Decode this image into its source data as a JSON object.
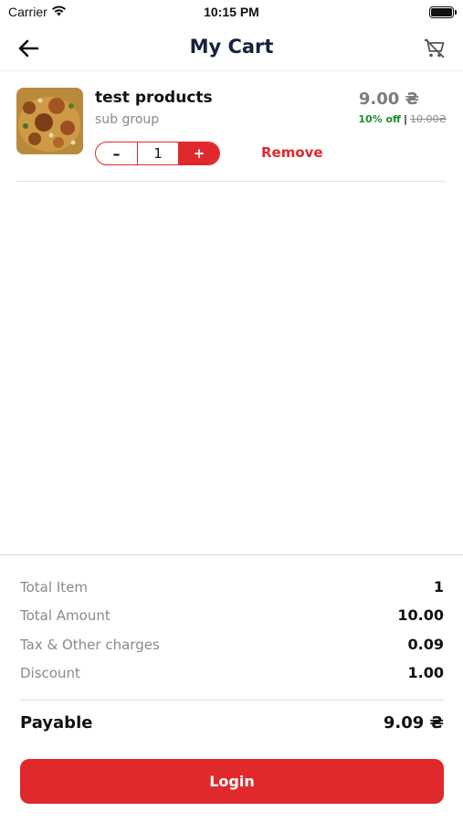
{
  "status_bar": {
    "carrier": "Carrier",
    "time": "10:15 PM",
    "wifi_icon": "wifi-icon",
    "battery_icon": "battery-icon"
  },
  "nav": {
    "title": "My Cart",
    "back_icon": "arrow-left-icon",
    "clear_cart_icon": "cart-remove-icon"
  },
  "cart_items": [
    {
      "name": "test products",
      "group": "sub group",
      "price": "9.00 ₴",
      "discount": "10% off",
      "separator": "|",
      "original_price": "10.00₴",
      "quantity": "1",
      "minus_label": "–",
      "plus_label": "+",
      "remove_label": "Remove"
    }
  ],
  "summary": {
    "total_item_label": "Total Item",
    "total_item_value": "1",
    "total_amount_label": "Total Amount",
    "total_amount_value": "10.00",
    "tax_label": "Tax & Other charges",
    "tax_value": "0.09",
    "discount_label": "Discount",
    "discount_value": "1.00",
    "payable_label": "Payable",
    "payable_value": "9.09 ₴",
    "login_label": "Login"
  },
  "colors": {
    "accent": "#e0292d",
    "title": "#16213b",
    "discount_green": "#1d8d2d",
    "muted_text": "#8a8a8a"
  }
}
